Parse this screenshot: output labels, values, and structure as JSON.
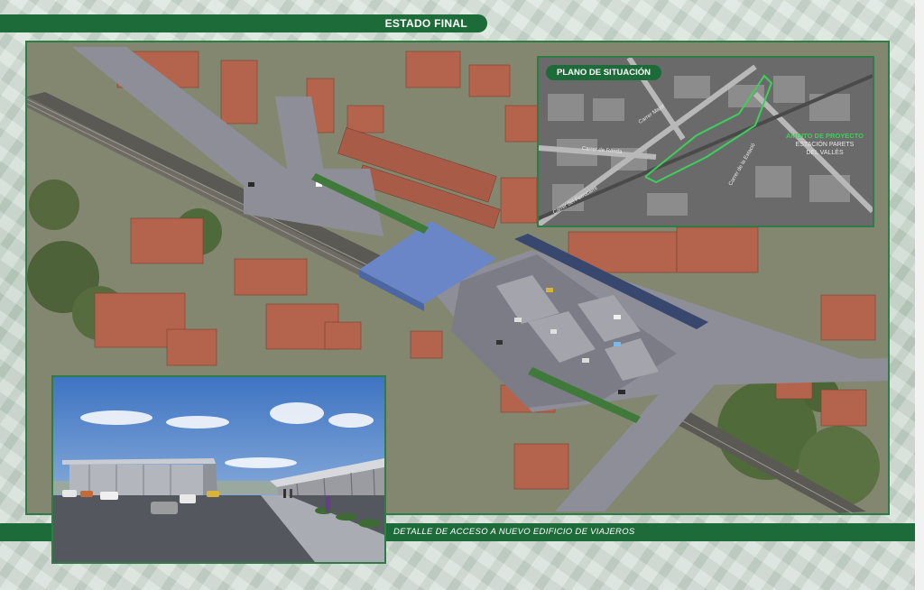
{
  "header": {
    "title": "ESTADO FINAL"
  },
  "location_plan": {
    "label": "PLANO DE SITUACIÓN",
    "area_title": "ÁMBITO DE PROYECTO",
    "area_subtitle_1": "ESTACIÓN PARETS",
    "area_subtitle_2": "DEL VALLÈS",
    "streets": [
      "Carrer de Ronda",
      "Carrer del Ferrocarril",
      "Carrer Major",
      "Carrer de la Estació"
    ]
  },
  "footer": {
    "caption": "DETALLE DE ACCESO A NUEVO EDIFICIO DE VIAJEROS"
  },
  "colors": {
    "brand_green": "#1e6b3a",
    "frame_green": "#2e7d46",
    "boundary_green": "#3cd05a"
  }
}
